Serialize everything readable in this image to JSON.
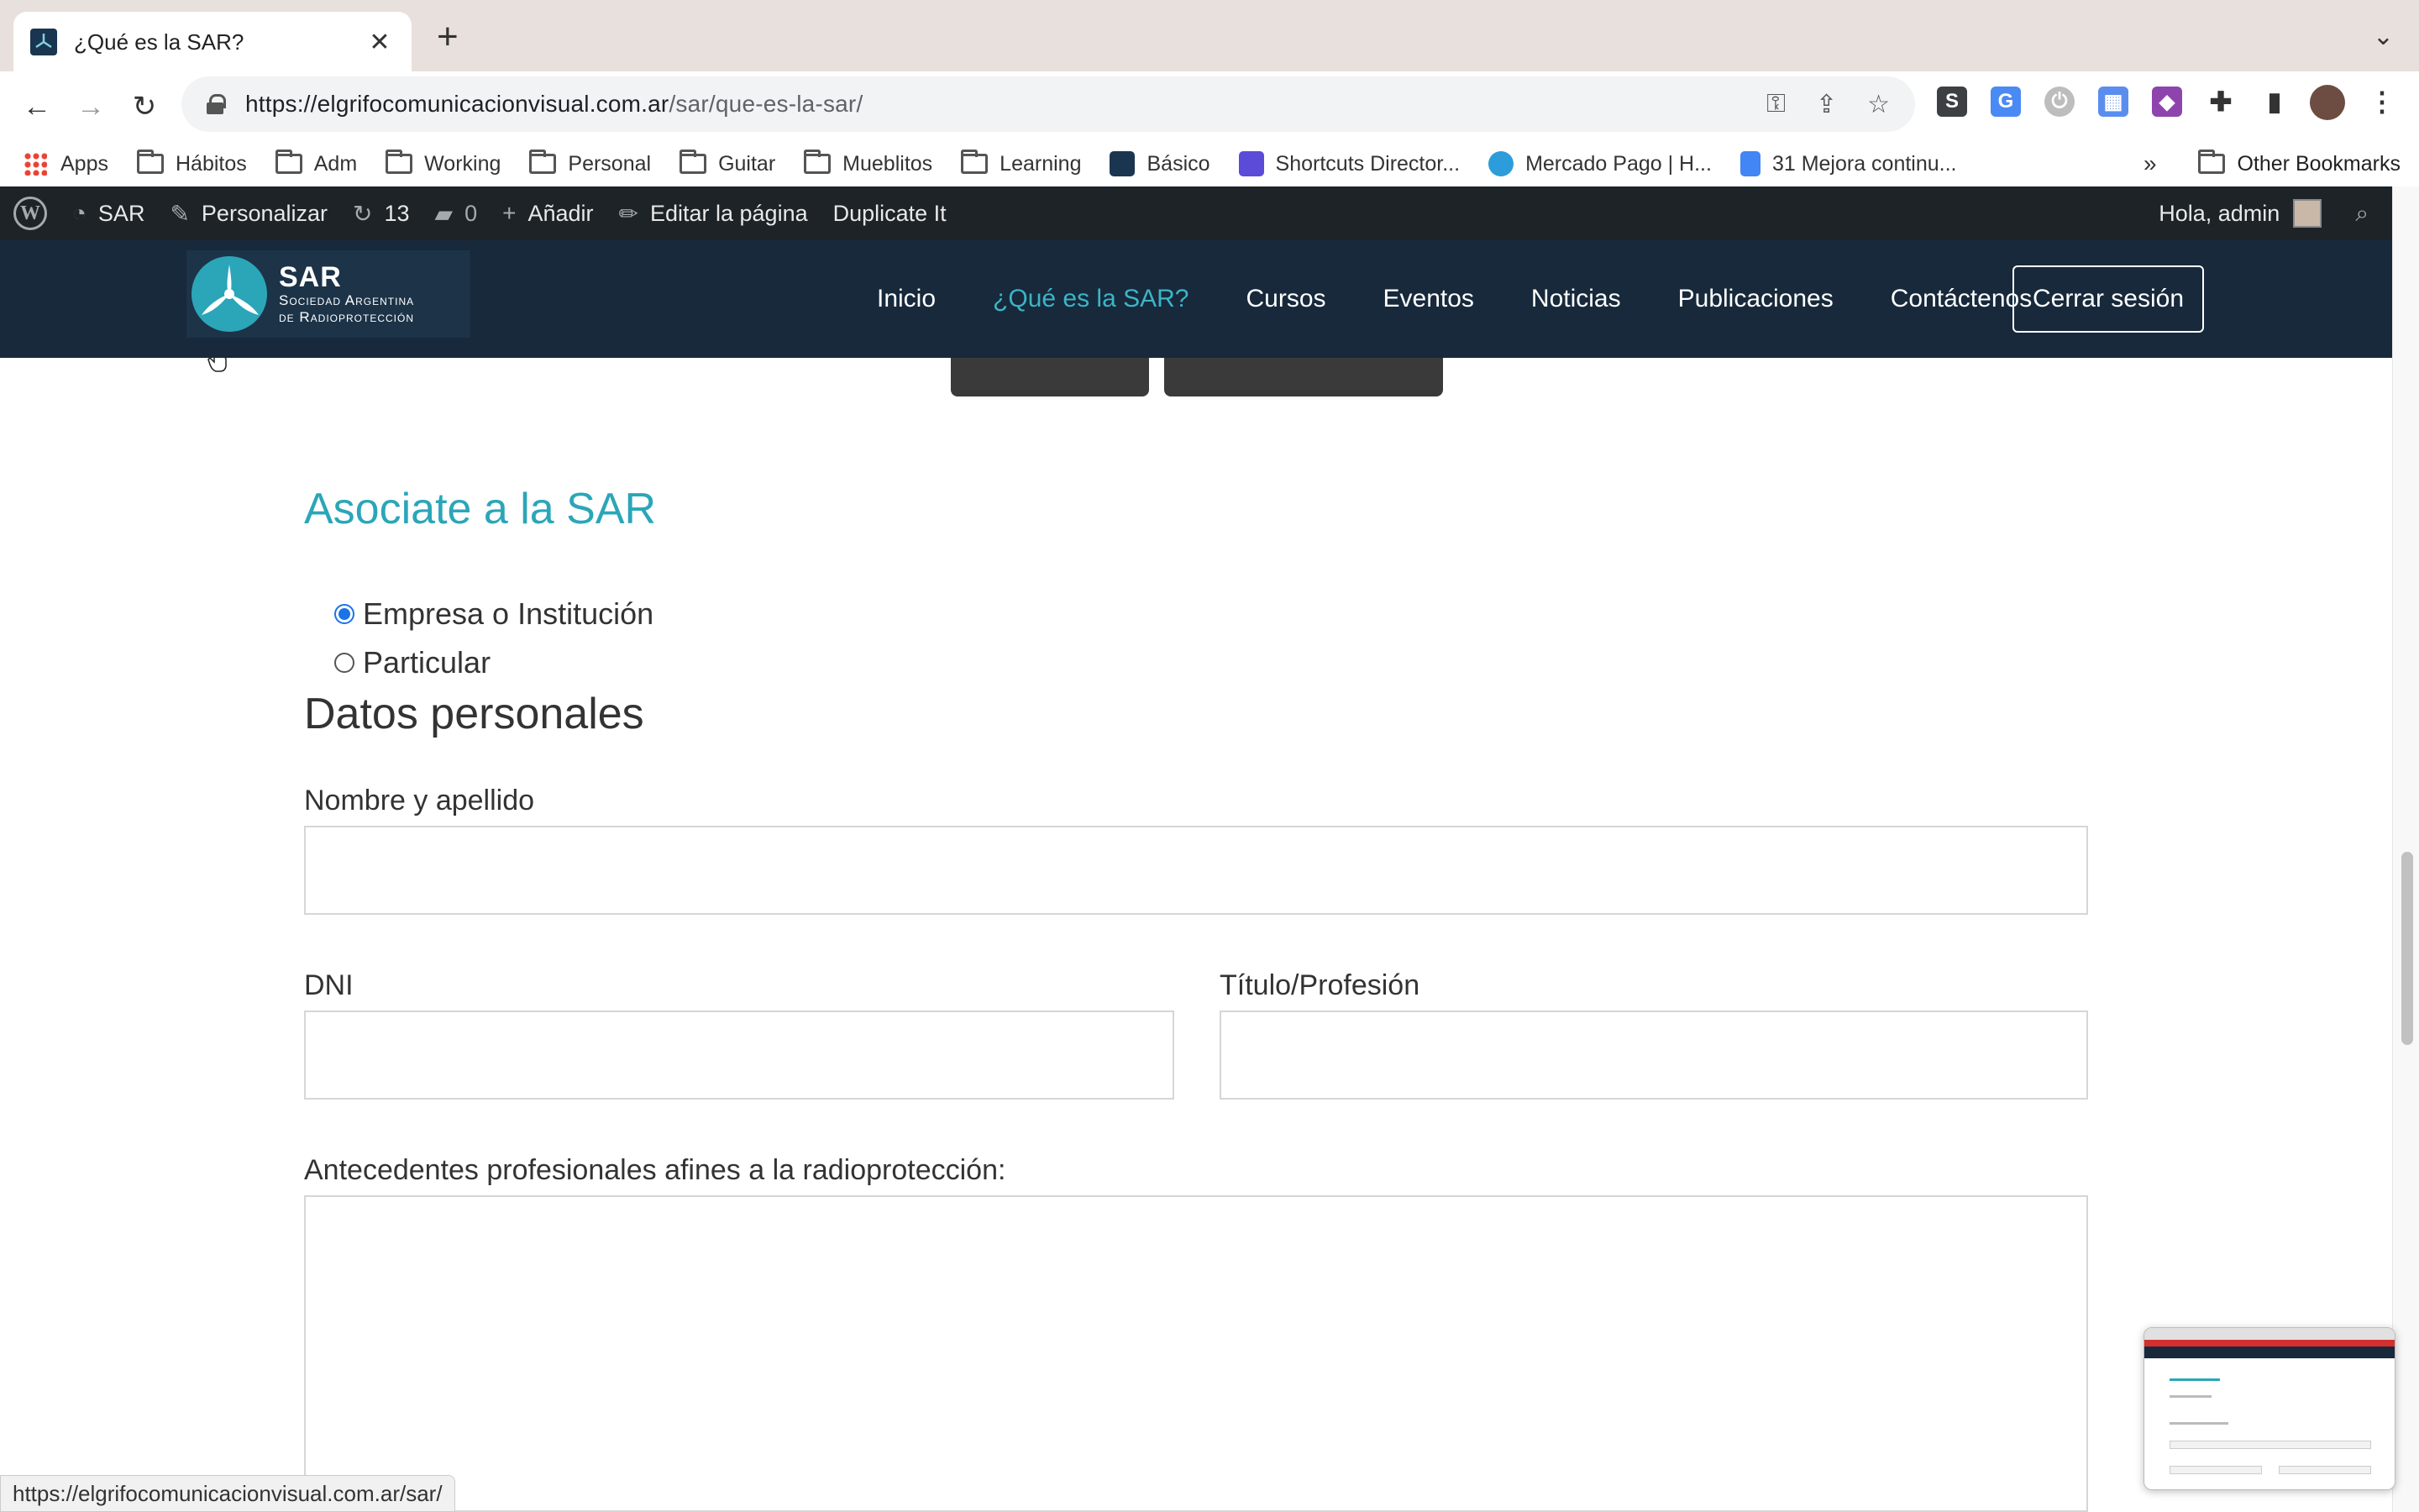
{
  "browser": {
    "tab_title": "¿Qué es la SAR?",
    "url_host": "https://elgrifocomunicacionvisual.com.ar",
    "url_path": "/sar/que-es-la-sar/",
    "bookmarks": [
      {
        "label": "Apps",
        "type": "apps"
      },
      {
        "label": "Hábitos",
        "type": "folder"
      },
      {
        "label": "Adm",
        "type": "folder"
      },
      {
        "label": "Working",
        "type": "folder"
      },
      {
        "label": "Personal",
        "type": "folder"
      },
      {
        "label": "Guitar",
        "type": "folder"
      },
      {
        "label": "Mueblitos",
        "type": "folder"
      },
      {
        "label": "Learning",
        "type": "folder"
      },
      {
        "label": "Básico",
        "type": "site"
      },
      {
        "label": "Shortcuts Director...",
        "type": "site"
      },
      {
        "label": "Mercado Pago | H...",
        "type": "site"
      },
      {
        "label": "31 Mejora continu...",
        "type": "doc"
      }
    ],
    "more_bookmarks": "»",
    "other_bookmarks": "Other Bookmarks",
    "status_url": "https://elgrifocomunicacionvisual.com.ar/sar/"
  },
  "wp_admin_bar": {
    "site_name": "SAR",
    "customize": "Personalizar",
    "updates_count": "13",
    "comments_count": "0",
    "add_new": "Añadir",
    "edit_page": "Editar la página",
    "duplicate": "Duplicate It",
    "greeting": "Hola, admin"
  },
  "site": {
    "logo_title": "SAR",
    "logo_line1": "Sociedad Argentina",
    "logo_line2": "de Radioprotección",
    "nav": [
      "Inicio",
      "¿Qué es la SAR?",
      "Cursos",
      "Eventos",
      "Noticias",
      "Publicaciones",
      "Contáctenos"
    ],
    "active_nav": "¿Qué es la SAR?",
    "logout": "Cerrar sesión"
  },
  "form": {
    "title": "Asociate a la SAR",
    "membership_options": [
      {
        "label": "Empresa o Institución",
        "checked": true
      },
      {
        "label": "Particular",
        "checked": false
      }
    ],
    "section_heading": "Datos personales",
    "name_label": "Nombre y apellido",
    "name_value": "",
    "dni_label": "DNI",
    "dni_value": "",
    "title_label": "Título/Profesión",
    "title_value": "",
    "background_label": "Antecedentes profesionales afines a la radioprotección:",
    "background_value": ""
  },
  "colors": {
    "accent": "#2ba6b8",
    "header_bg": "#17293b",
    "wp_bar_bg": "#1d2327"
  }
}
